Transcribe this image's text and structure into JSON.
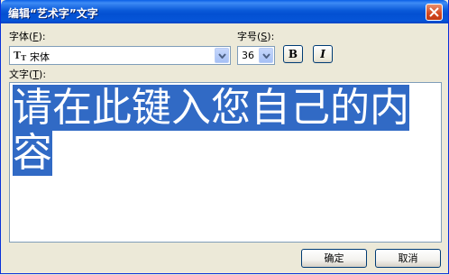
{
  "dialog": {
    "title": "编辑“艺术字”文字",
    "close_icon": "close-icon"
  },
  "font": {
    "label": "字体",
    "accel": "F",
    "value": "宋体",
    "icon": "truetype-font-icon"
  },
  "size": {
    "label": "字号",
    "accel": "S",
    "value": "36"
  },
  "bold_label": "B",
  "italic_label": "I",
  "text": {
    "label": "文字",
    "accel": "T",
    "value": "请在此键入您自己的内容"
  },
  "buttons": {
    "ok": "确定",
    "cancel": "取消"
  },
  "colors": {
    "selection": "#316ac5",
    "titlebar": "#0a59d8"
  }
}
